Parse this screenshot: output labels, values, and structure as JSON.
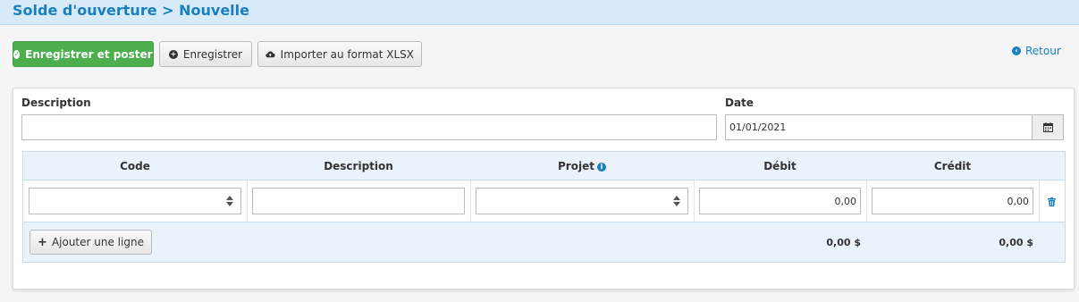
{
  "header": {
    "title": "Solde d'ouverture > Nouvelle"
  },
  "toolbar": {
    "save_post_label": "Enregistrer et poster",
    "save_label": "Enregistrer",
    "import_label": "Importer au format XLSX",
    "back_label": "Retour"
  },
  "form": {
    "description_label": "Description",
    "description_value": "",
    "date_label": "Date",
    "date_value": "01/01/2021"
  },
  "table": {
    "columns": [
      "Code",
      "Description",
      "Projet",
      "Débit",
      "Crédit"
    ],
    "rows": [
      {
        "code": "",
        "description": "",
        "projet": "",
        "debit": "0,00",
        "credit": "0,00"
      }
    ],
    "add_line_label": "Ajouter une ligne",
    "total_debit": "0,00 $",
    "total_credit": "0,00 $"
  },
  "colors": {
    "accent": "#1a7fbf",
    "success": "#4cae4c",
    "header_bg": "#d6eaf8",
    "table_header_bg": "#eaf3fb"
  },
  "icons": [
    "check-circle-icon",
    "plus-circle-icon",
    "cloud-upload-icon",
    "arrow-left-circle-icon",
    "calendar-icon",
    "info-icon",
    "sort-icon",
    "trash-icon",
    "plus-icon"
  ]
}
